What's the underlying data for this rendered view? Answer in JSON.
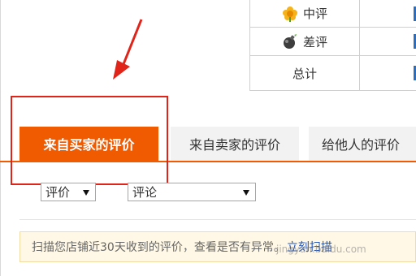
{
  "ratings_table": {
    "rows": [
      {
        "label": "中评",
        "icon": "neutral-rating-flower-icon"
      },
      {
        "label": "差评",
        "icon": "negative-rating-bomb-icon"
      },
      {
        "label": "总计",
        "icon": ""
      }
    ]
  },
  "tabs": [
    {
      "label": "来自买家的评价",
      "active": true
    },
    {
      "label": "来自卖家的评价",
      "active": false
    },
    {
      "label": "给他人的评价",
      "active": false
    }
  ],
  "filters": {
    "rating_select": "评价",
    "comment_select": "评论"
  },
  "notice": {
    "text": "扫描您店铺近30天收到的评价，查看是否有异常。",
    "link": "立刻扫描"
  },
  "watermark": "jingyan.baidu.com",
  "colors": {
    "accent": "#f05a00",
    "highlight": "#e0241a",
    "link": "#2456b5",
    "notice_bg": "#fff8e6"
  }
}
